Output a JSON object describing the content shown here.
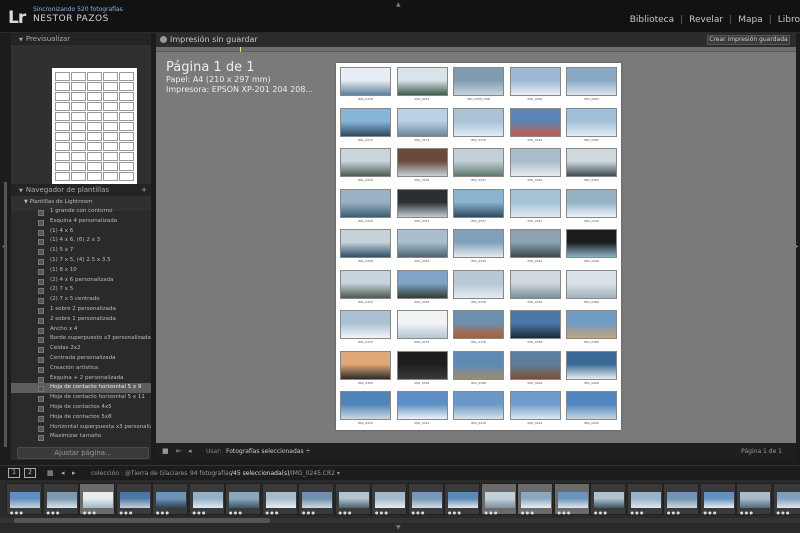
{
  "app": {
    "logo": "Lr",
    "sync_text": "Sincronizando 520 fotografías",
    "user_name": "NESTOR PAZOS",
    "modules": [
      "Biblioteca",
      "Revelar",
      "Mapa",
      "Libro"
    ]
  },
  "left_panel": {
    "preview_title": "Previsualizar",
    "templates_title": "Navegador de plantillas",
    "add_label": "+",
    "folder_label": "Plantillas de Lightroom",
    "templates": [
      "1 grande con contorno",
      "Esquina 4 personalizada",
      "(1) 4 x 6",
      "(1) 4 x 6, (6) 2 x 3",
      "(1) 5 x 7",
      "(1) 7 x 5, (4) 2.5 x 3.5",
      "(1) 8 x 10",
      "(2) 4 x 6 personalizada",
      "(2) 7 x 5",
      "(2) 7 x 5 centrado",
      "1 sobre 2 personalizada",
      "2 sobre 1 personalizada",
      "Ancho x 4",
      "Borde superpuesto x3 personalizada",
      "Celdas 2x2",
      "Centrada personalizada",
      "Creación artística",
      "Esquina + 2 personalizada",
      "Hoja de contacto horizontal 5 x 9",
      "Hoja de contacto horizontal 5 x 11",
      "Hoja de contactos 4x5",
      "Hoja de contactos 5x8",
      "Horizontal superpuesta x3 personaliz...",
      "Maximizar tamaño"
    ],
    "selected_template_index": 18,
    "adjust_button": "Ajustar página..."
  },
  "document": {
    "title": "Impresión sin guardar",
    "save_button": "Crear impresión guardada",
    "page_title": "Página 1 de 1",
    "paper": "Papel: A4 (210 x 297 mm)",
    "printer": "Impresora: EPSON XP-201 204 208..."
  },
  "contact_sheet": {
    "columns": 5,
    "rows": 9,
    "thumbnails": [
      {
        "name": "IMG_0248",
        "c1": "#e8eef5",
        "c2": "#5f7f9c"
      },
      {
        "name": "IMG_0251",
        "c1": "#d9e3ea",
        "c2": "#3e5a4a"
      },
      {
        "name": "IMG_0255_HDR",
        "c1": "#7e9bb0",
        "c2": "#c7d4de"
      },
      {
        "name": "IMG_0260",
        "c1": "#9fb7d1",
        "c2": "#e9eff4"
      },
      {
        "name": "IMG_0263",
        "c1": "#8aa9c4",
        "c2": "#dbe5ed"
      },
      {
        "name": "IMG_0270",
        "c1": "#87b5d8",
        "c2": "#2d4a5e"
      },
      {
        "name": "IMG_0274",
        "c1": "#b9d3e4",
        "c2": "#6b8799"
      },
      {
        "name": "IMG_0278",
        "c1": "#a9c2d5",
        "c2": "#e3ecf1"
      },
      {
        "name": "IMG_0281",
        "c1": "#5c85b5",
        "c2": "#c25b4a"
      },
      {
        "name": "IMG_0285",
        "c1": "#a2c0d8",
        "c2": "#e4edf3"
      },
      {
        "name": "IMG_0290",
        "c1": "#c9d4db",
        "c2": "#4e5a52"
      },
      {
        "name": "IMG_0293",
        "c1": "#6a4a3a",
        "c2": "#c8d2d8"
      },
      {
        "name": "IMG_0297",
        "c1": "#c2d0d8",
        "c2": "#5c7a6c"
      },
      {
        "name": "IMG_0301",
        "c1": "#aabdc8",
        "c2": "#e6eef2"
      },
      {
        "name": "IMG_0305",
        "c1": "#d0d9de",
        "c2": "#3f4c55"
      },
      {
        "name": "IMG_0310",
        "c1": "#9ab3c4",
        "c2": "#3b5d72"
      },
      {
        "name": "IMG_0313",
        "c1": "#2b2f33",
        "c2": "#c0ccd4"
      },
      {
        "name": "IMG_0317",
        "c1": "#8ab3cf",
        "c2": "#2a4a5e"
      },
      {
        "name": "IMG_0321",
        "c1": "#a6c3d6",
        "c2": "#e0eaf0"
      },
      {
        "name": "IMG_0326",
        "c1": "#95b2c5",
        "c2": "#f0f4f6"
      },
      {
        "name": "IMG_0330",
        "c1": "#c5d2da",
        "c2": "#2f4e68"
      },
      {
        "name": "IMG_0334",
        "c1": "#a7bfd0",
        "c2": "#4d6373"
      },
      {
        "name": "IMG_0339",
        "c1": "#7f9fbb",
        "c2": "#e6ecf0"
      },
      {
        "name": "IMG_0342",
        "c1": "#8ea3b2",
        "c2": "#3a4650"
      },
      {
        "name": "IMG_0346",
        "c1": "#1c1c1c",
        "c2": "#8ab0c8"
      },
      {
        "name": "IMG_0350",
        "c1": "#c8d3db",
        "c2": "#4b5a4e"
      },
      {
        "name": "IMG_0354",
        "c1": "#7fa4c5",
        "c2": "#2f3d36"
      },
      {
        "name": "IMG_0358",
        "c1": "#b8c8d4",
        "c2": "#e5ebef"
      },
      {
        "name": "IMG_0362",
        "c1": "#cfd9df",
        "c2": "#7c8e98"
      },
      {
        "name": "IMG_0366",
        "c1": "#d8e1e6",
        "c2": "#a2b3bd"
      },
      {
        "name": "IMG_0370",
        "c1": "#a9c1d3",
        "c2": "#f2f5f7"
      },
      {
        "name": "IMG_0374",
        "c1": "#f0f3f5",
        "c2": "#b9c7d0"
      },
      {
        "name": "IMG_0378",
        "c1": "#6c8fae",
        "c2": "#b45a2a"
      },
      {
        "name": "IMG_0382",
        "c1": "#4a78a8",
        "c2": "#1e2a33"
      },
      {
        "name": "IMG_0386",
        "c1": "#6f9cc6",
        "c2": "#c6a478"
      },
      {
        "name": "IMG_0390",
        "c1": "#e1a777",
        "c2": "#2b2b2b"
      },
      {
        "name": "IMG_0394",
        "c1": "#1d1d1d",
        "c2": "#3a3a3a"
      },
      {
        "name": "IMG_0398",
        "c1": "#5e8ab5",
        "c2": "#9c8d6e"
      },
      {
        "name": "IMG_0402",
        "c1": "#5d7e9a",
        "c2": "#7b4f34"
      },
      {
        "name": "IMG_0406",
        "c1": "#3b6a98",
        "c2": "#e9eef2"
      },
      {
        "name": "IMG_0410",
        "c1": "#4f84b8",
        "c2": "#ccd8e1"
      },
      {
        "name": "IMG_0414",
        "c1": "#5d8fc4",
        "c2": "#eef3f6"
      },
      {
        "name": "IMG_0418",
        "c1": "#6a97c6",
        "c2": "#d9e3ea"
      },
      {
        "name": "IMG_0422",
        "c1": "#6f9ccd",
        "c2": "#e2e9ee"
      },
      {
        "name": "IMG_0426",
        "c1": "#4f86c0",
        "c2": "#c8d5df"
      }
    ]
  },
  "center_toolbar": {
    "use_label": "Usar:",
    "use_value": "Fotografías seleccionadas ÷",
    "page_indicator": "Página 1 de 1"
  },
  "filmbar": {
    "monitor_1": "1",
    "monitor_2": "2",
    "collection": "colección : @Tierra de Glaciares",
    "count": "94 fotografías",
    "selected": "/45 seleccionada(s)",
    "file": "/IMG_0245.CR2 ▾"
  },
  "filmstrip": {
    "frames": [
      {
        "c1": "#5f8fbf",
        "c2": "#c9d5de",
        "sel": false
      },
      {
        "c1": "#7d9ab0",
        "c2": "#dbe4ea",
        "sel": false
      },
      {
        "c1": "#e6ecf0",
        "c2": "#a3b5c2",
        "sel": true
      },
      {
        "c1": "#4d77a3",
        "c2": "#c4d2dc",
        "sel": false
      },
      {
        "c1": "#6e93b8",
        "c2": "#2d4050",
        "sel": false
      },
      {
        "c1": "#93b0c6",
        "c2": "#e3eaef",
        "sel": false
      },
      {
        "c1": "#8ca8bd",
        "c2": "#3a5566",
        "sel": false
      },
      {
        "c1": "#a7bccb",
        "c2": "#e8eef2",
        "sel": false
      },
      {
        "c1": "#6f8fae",
        "c2": "#cfdbe3",
        "sel": false
      },
      {
        "c1": "#b3c4d0",
        "c2": "#4b5f6c",
        "sel": false
      },
      {
        "c1": "#a3b9c9",
        "c2": "#e7edf1",
        "sel": false
      },
      {
        "c1": "#7698b6",
        "c2": "#d3dee6",
        "sel": false
      },
      {
        "c1": "#5c88b4",
        "c2": "#e4eaef",
        "sel": false
      },
      {
        "c1": "#c5d1d9",
        "c2": "#7c8f9b",
        "sel": true
      },
      {
        "c1": "#8aa7bf",
        "c2": "#ecf1f4",
        "sel": true
      },
      {
        "c1": "#6c93bb",
        "c2": "#dde6ec",
        "sel": true
      },
      {
        "c1": "#b0c2cf",
        "c2": "#3f5260",
        "sel": false
      },
      {
        "c1": "#9ab2c5",
        "c2": "#e0e8ed",
        "sel": false
      },
      {
        "c1": "#7394b3",
        "c2": "#cbd8e1",
        "sel": false
      },
      {
        "c1": "#6590bd",
        "c2": "#e8eef2",
        "sel": false
      },
      {
        "c1": "#a8bccb",
        "c2": "#56697a",
        "sel": false
      },
      {
        "c1": "#809fbd",
        "c2": "#dfe7ec",
        "sel": false
      }
    ]
  }
}
